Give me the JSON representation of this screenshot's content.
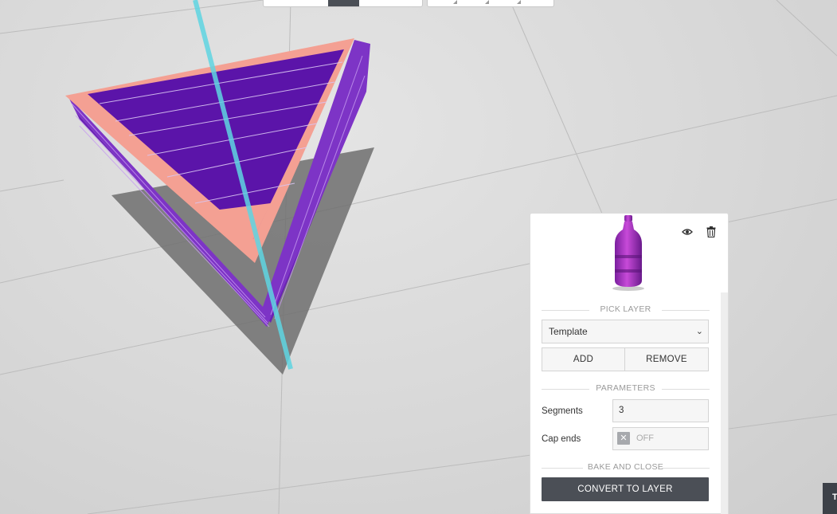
{
  "panel": {
    "thumbnail_icon": "bottle-shape-icon",
    "visibility_icon": "eye-icon",
    "delete_icon": "trash-icon",
    "pick_layer_heading": "PICK LAYER",
    "layer_select_value": "Template",
    "add_label": "ADD",
    "remove_label": "REMOVE",
    "parameters_heading": "PARAMETERS",
    "segments_label": "Segments",
    "segments_value": "3",
    "cap_ends_label": "Cap ends",
    "cap_ends_state": "OFF",
    "bake_heading": "BAKE AND CLOSE",
    "convert_label": "CONVERT TO LAYER"
  },
  "corner_tab": {
    "label": "T"
  },
  "colors": {
    "shape_fill": "#5a14a8",
    "shape_side": "#7a2fc0",
    "shape_edge": "#f4a093",
    "axis": "#5fd5e2",
    "primary_button": "#4b4f56"
  }
}
